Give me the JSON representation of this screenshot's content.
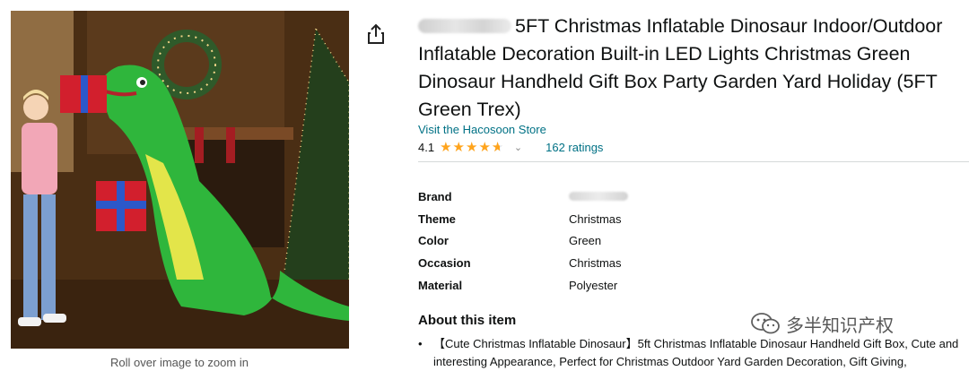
{
  "product": {
    "title": "5FT Christmas Inflatable Dinosaur Indoor/Outdoor Inflatable Decoration Built-in LED Lights Christmas Green Dinosaur Handheld Gift Box Party Garden Yard Holiday (5FT Green Trex)",
    "store_link": "Visit the Hacosoon Store",
    "rating_value": "4.1",
    "rating_fraction": 0.82,
    "ratings_count": "162 ratings",
    "zoom_hint": "Roll over image to zoom in"
  },
  "specs": [
    {
      "key": "Brand",
      "value": ""
    },
    {
      "key": "Theme",
      "value": "Christmas"
    },
    {
      "key": "Color",
      "value": "Green"
    },
    {
      "key": "Occasion",
      "value": "Christmas"
    },
    {
      "key": "Material",
      "value": "Polyester"
    }
  ],
  "about": {
    "title": "About this item",
    "bullet_marker": "•",
    "bullet1": "【Cute Christmas Inflatable Dinosaur】5ft Christmas Inflatable Dinosaur Handheld Gift Box, Cute and interesting Appearance, Perfect for Christmas Outdoor Yard Garden Decoration, Gift Giving,"
  },
  "watermark": {
    "text": "多半知识产权"
  },
  "colors": {
    "link": "#007185",
    "star": "#FFA41C",
    "text": "#0F1111"
  },
  "icons": {
    "share": "share-icon",
    "chevron": "chevron-down-icon",
    "star": "star-icon",
    "watermark_logo": "wechat-logo-icon"
  }
}
